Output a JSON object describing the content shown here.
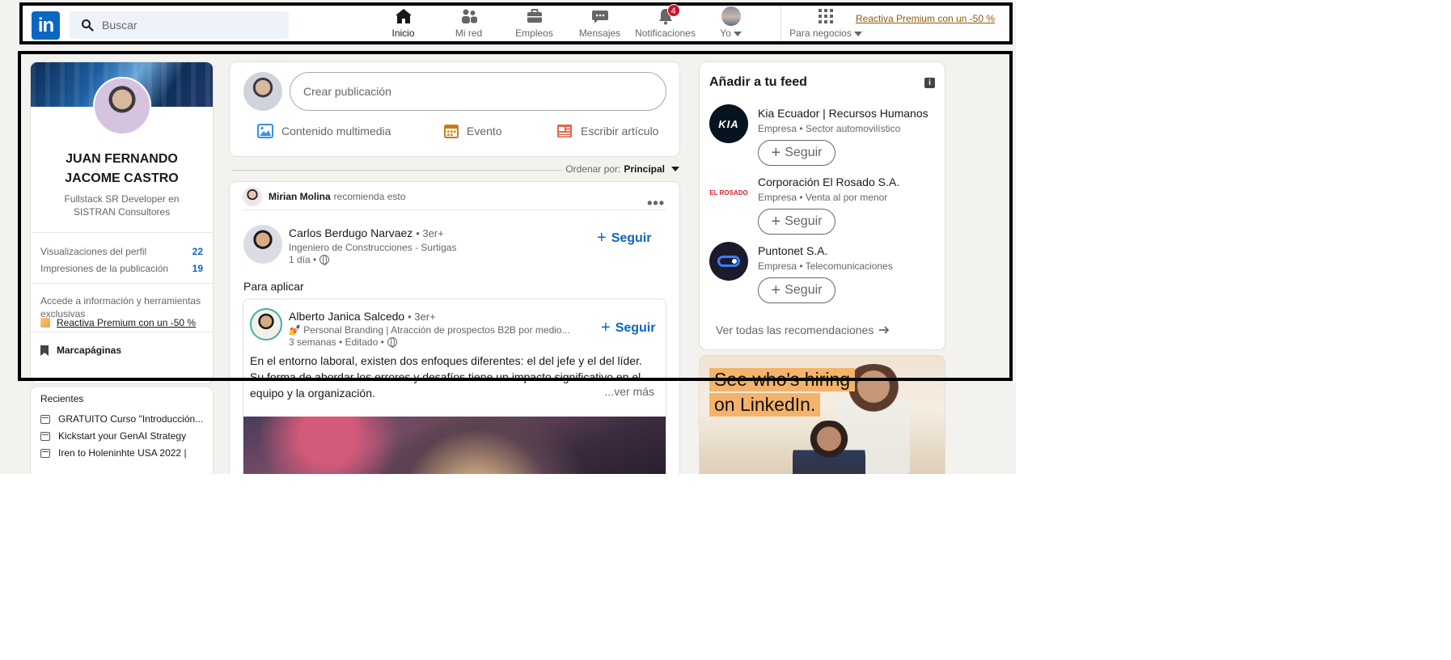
{
  "topnav": {
    "logo": "in",
    "search_placeholder": "Buscar",
    "items": [
      {
        "label": "Inicio"
      },
      {
        "label": "Mi red"
      },
      {
        "label": "Empleos"
      },
      {
        "label": "Mensajes"
      },
      {
        "label": "Notificaciones",
        "badge": "4"
      },
      {
        "label": "Yo"
      }
    ],
    "business_label": "Para negocios",
    "premium_link": "Reactiva Premium con un -50 %"
  },
  "profile": {
    "name": "JUAN FERNANDO JACOME CASTRO",
    "headline": "Fullstack SR Developer en SISTRAN Consultores",
    "stats": [
      {
        "label": "Visualizaciones del perfil",
        "value": "22"
      },
      {
        "label": "Impresiones de la publicación",
        "value": "19"
      }
    ],
    "access_text": "Accede a información y herramientas exclusivas",
    "premium_link": "Reactiva Premium con un -50 %",
    "bookmarks": "Marcapáginas"
  },
  "recent": {
    "title": "Recientes",
    "items": [
      "GRATUITO Curso \"Introducción...",
      "Kickstart your GenAI Strategy",
      "Iren to Holeninhte USA 2022 |"
    ]
  },
  "share": {
    "placeholder": "Crear publicación",
    "actions": [
      "Contenido multimedia",
      "Evento",
      "Escribir artículo"
    ]
  },
  "sort": {
    "label": "Ordenar por:",
    "value": "Principal"
  },
  "post": {
    "recommender": "Mirian Molina",
    "recommend_text": "recomienda esto",
    "author": {
      "name": "Carlos Berdugo Narvaez",
      "degree": "• 3er+",
      "headline": "Ingeniero de Construcciones - Surtigas",
      "time": "1 día •"
    },
    "follow_label": "Seguir",
    "text": "Para aplicar",
    "shared": {
      "name": "Alberto Janica Salcedo",
      "degree": "• 3er+",
      "headline": "💅 Personal Branding | Atracción de prospectos B2B por medio...",
      "time": "3 semanas • Editado •",
      "follow_label": "Seguir",
      "body": "En el entorno laboral, existen dos enfoques diferentes: el del jefe y el del líder. Su forma de abordar los errores y desafíos tiene un impacto significativo en el equipo y la organización.",
      "see_more": "...ver más"
    }
  },
  "feed": {
    "title": "Añadir a tu feed",
    "companies": [
      {
        "name": "Kia Ecuador | Recursos Humanos",
        "sub": "Empresa • Sector automovilístico",
        "logo_text": "KIA",
        "button": "Seguir"
      },
      {
        "name": "Corporación El Rosado S.A.",
        "sub": "Empresa • Venta al por menor",
        "logo_text": "EL ROSADO",
        "button": "Seguir"
      },
      {
        "name": "Puntonet S.A.",
        "sub": "Empresa • Telecomunicaciones",
        "logo_text": "",
        "button": "Seguir"
      }
    ],
    "see_all": "Ver todas las recomendaciones"
  },
  "ad": {
    "line1": "See who's hiring",
    "line2": "on LinkedIn."
  },
  "colors": {
    "linkedin_blue": "#0a66c2",
    "background": "#f4f2ee",
    "premium_gold": "#915907",
    "badge_red": "#cb112d"
  }
}
